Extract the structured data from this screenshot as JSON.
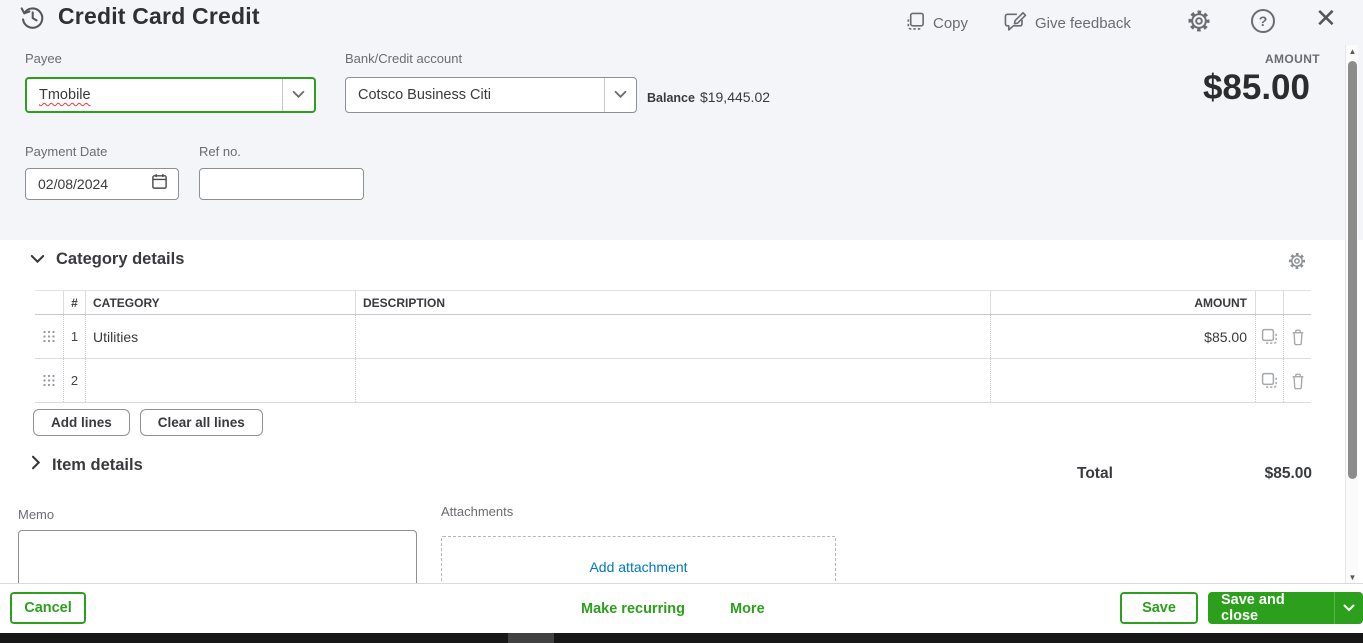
{
  "header": {
    "title": "Credit Card Credit",
    "actions": {
      "copy": "Copy",
      "give_feedback": "Give feedback"
    }
  },
  "form": {
    "payee": {
      "label": "Payee",
      "value": "Tmobile"
    },
    "account": {
      "label": "Bank/Credit account",
      "value": "Cotsco Business Citi",
      "balance_label": "Balance",
      "balance_value": "$19,445.02"
    },
    "amount": {
      "label": "AMOUNT",
      "value": "$85.00"
    },
    "payment_date": {
      "label": "Payment Date",
      "value": "02/08/2024"
    },
    "ref_no": {
      "label": "Ref no.",
      "value": ""
    }
  },
  "category_details": {
    "title": "Category details",
    "columns": {
      "num": "#",
      "category": "CATEGORY",
      "description": "DESCRIPTION",
      "amount": "AMOUNT"
    },
    "rows": [
      {
        "num": "1",
        "category": "Utilities",
        "description": "",
        "amount": "$85.00"
      },
      {
        "num": "2",
        "category": "",
        "description": "",
        "amount": ""
      }
    ],
    "buttons": {
      "add_lines": "Add lines",
      "clear_all_lines": "Clear all lines"
    }
  },
  "item_details": {
    "title": "Item details"
  },
  "totals": {
    "label": "Total",
    "value": "$85.00"
  },
  "memo": {
    "label": "Memo",
    "value": ""
  },
  "attachments": {
    "label": "Attachments",
    "add_link": "Add attachment"
  },
  "footer": {
    "cancel": "Cancel",
    "make_recurring": "Make recurring",
    "more": "More",
    "save": "Save",
    "save_and_close": "Save and close"
  },
  "icons": {
    "close": "✕",
    "help": "?",
    "scroll_up": "▲",
    "scroll_down": "▼"
  },
  "colors": {
    "accent_green": "#2ca01c",
    "link_blue": "#0077c5",
    "text_dark": "#393a3d",
    "label_gray": "#6b6c72",
    "panel_bg": "#f4f5f8"
  }
}
